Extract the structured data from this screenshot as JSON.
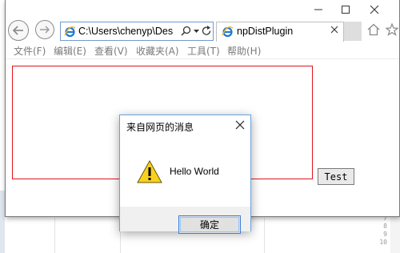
{
  "window": {
    "address_text": "C:\\Users\\chenyp\\Des",
    "tab_title": "npDistPlugin"
  },
  "menu": {
    "items": [
      {
        "label": "文件(F)"
      },
      {
        "label": "编辑(E)"
      },
      {
        "label": "查看(V)"
      },
      {
        "label": "收藏夹(A)"
      },
      {
        "label": "工具(T)"
      },
      {
        "label": "帮助(H)"
      }
    ]
  },
  "page": {
    "test_button_label": "Test"
  },
  "dialog": {
    "title": "来自网页的消息",
    "message": "Hello World",
    "ok_label": "确定"
  },
  "background": {
    "line_numbers": [
      "7",
      "8",
      "9",
      "10"
    ]
  },
  "colors": {
    "plugin_border": "#e0141e",
    "address_border": "#6f9bd1",
    "dialog_border": "#6aa0d8",
    "warning_yellow": "#f7d11e"
  },
  "icons": {
    "back": "back-arrow-icon",
    "forward": "forward-arrow-icon",
    "ie_logo": "ie-logo-icon",
    "search": "search-icon",
    "refresh": "refresh-icon",
    "home": "home-icon",
    "favorites": "star-icon",
    "warning": "warning-icon"
  }
}
